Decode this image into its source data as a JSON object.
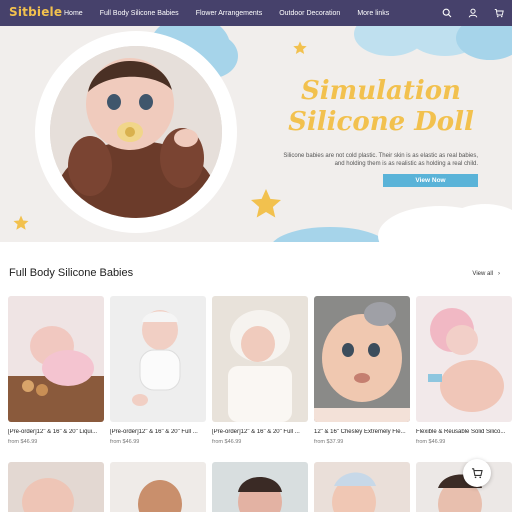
{
  "nav": {
    "logo": "Sitbiele",
    "items": [
      "Home",
      "Full Body Silicone Babies",
      "Flower Arrangements",
      "Outdoor Decoration",
      "More links"
    ],
    "icons": [
      "search-icon",
      "account-icon",
      "cart-icon"
    ],
    "background": "#46416b"
  },
  "hero": {
    "title_line1": "Simulation",
    "title_line2": "Silicone Doll",
    "description_line1": "Silicone babies are not cold plastic. Their skin is as elastic as real babies,",
    "description_line2": "and holding them is as realistic as holding a real child.",
    "button_label": "View Now",
    "accent": "#f2c14e",
    "button_color": "#5ab3d8"
  },
  "section": {
    "title": "Full Body Silicone Babies",
    "view_all": "View all"
  },
  "products": [
    {
      "name": "[Pre-order]12\" & 16\" & 20\" Liqui...",
      "price": "from $46.99"
    },
    {
      "name": "[Pre-order]12\" & 16\" & 20\" Full ...",
      "price": "from $46.99"
    },
    {
      "name": "[Pre-order]12\" & 16\" & 20\" Full ...",
      "price": "from $46.99"
    },
    {
      "name": "12\" & 16\" Chesley Extremely Fle...",
      "price": "from $37.99"
    },
    {
      "name": "Flexible & Reusable Solid Silico...",
      "price": "from $46.99"
    }
  ]
}
